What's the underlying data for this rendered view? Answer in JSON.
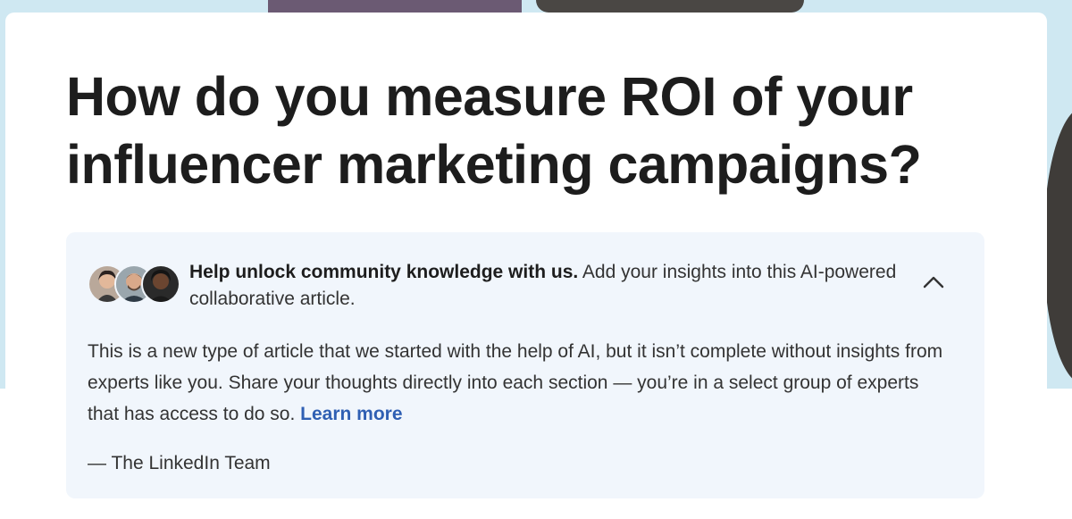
{
  "article": {
    "title": "How do you measure ROI of your influencer marketing campaigns?"
  },
  "notice": {
    "header_bold": "Help unlock community knowledge with us.",
    "header_text": " Add your insights into this AI-powered collaborative article.",
    "body_text": "This is a new type of article that we started with the help of AI, but it isn’t complete without insights from experts like you. Share your thoughts directly into each section — you’re in a select group of experts that has access to do so. ",
    "learn_more": "Learn more",
    "signature": "— The LinkedIn Team",
    "toggle_icon": "chevron-up-icon",
    "avatar_icons": [
      "avatar-1",
      "avatar-2",
      "avatar-3"
    ]
  },
  "colors": {
    "title": "#1d1d1d",
    "notice_bg": "#f1f6fc",
    "link": "#2f5fb3",
    "hero_bg": "#cfe8f2"
  }
}
